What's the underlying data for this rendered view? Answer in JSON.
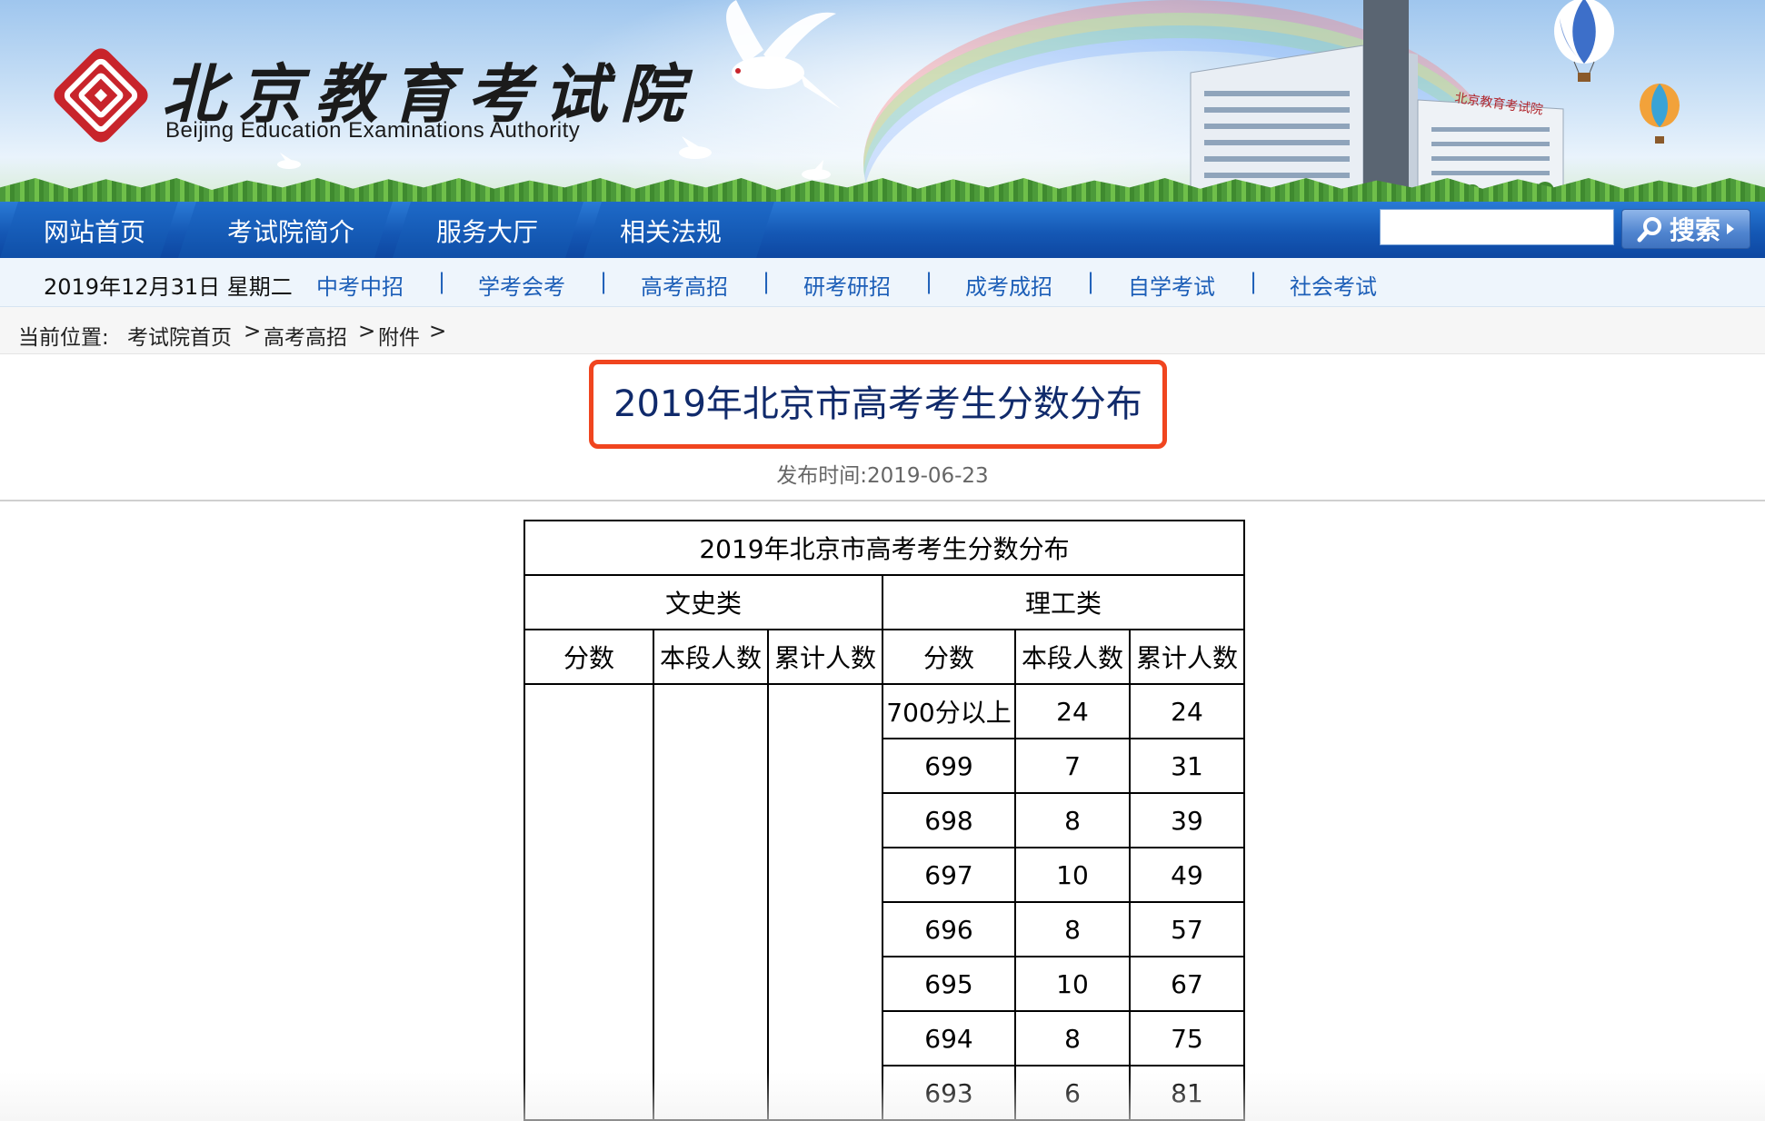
{
  "header": {
    "logo_title": "北京教育考试院",
    "logo_subtitle": "Beijing Education Examinations Authority",
    "building_sign": "北京教育考试院"
  },
  "main_nav": {
    "items": [
      "网站首页",
      "考试院简介",
      "服务大厅",
      "相关法规"
    ],
    "search_placeholder": "",
    "search_button": "搜索"
  },
  "sub_nav": {
    "date": "2019年12月31日 星期二",
    "links": [
      "中考中招",
      "学考会考",
      "高考高招",
      "研考研招",
      "成考成招",
      "自学考试",
      "社会考试"
    ],
    "separator": "|"
  },
  "breadcrumb": {
    "prefix": "当前位置:",
    "items": [
      "考试院首页",
      "高考高招",
      "附件"
    ],
    "separator": ">"
  },
  "article": {
    "title": "2019年北京市高考考生分数分布",
    "publish_time": "发布时间:2019-06-23"
  },
  "table": {
    "caption": "2019年北京市高考考生分数分布",
    "group_humanities": "文史类",
    "group_science": "理工类",
    "columns": [
      "分数",
      "本段人数",
      "累计人数"
    ],
    "science_rows": [
      {
        "score": "700分以上",
        "count": "24",
        "cumulative": "24"
      },
      {
        "score": "699",
        "count": "7",
        "cumulative": "31"
      },
      {
        "score": "698",
        "count": "8",
        "cumulative": "39"
      },
      {
        "score": "697",
        "count": "10",
        "cumulative": "49"
      },
      {
        "score": "696",
        "count": "8",
        "cumulative": "57"
      },
      {
        "score": "695",
        "count": "10",
        "cumulative": "67"
      },
      {
        "score": "694",
        "count": "8",
        "cumulative": "75"
      },
      {
        "score": "693",
        "count": "6",
        "cumulative": "81"
      }
    ]
  }
}
